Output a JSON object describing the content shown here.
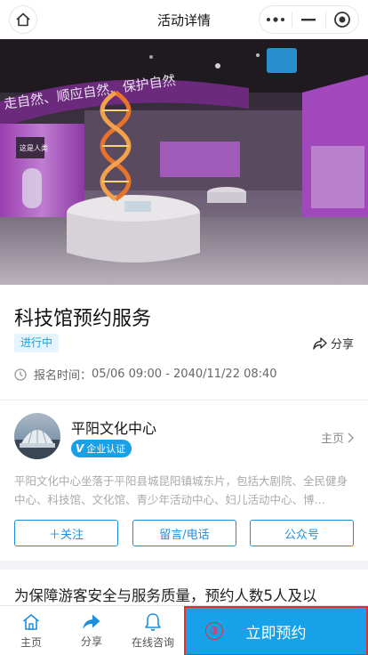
{
  "navbar": {
    "title": "活动详情",
    "icons": [
      "home-icon",
      "more-dots-icon",
      "minimize-icon",
      "close-target-icon"
    ]
  },
  "hero": {
    "banner_text": "走自然、顺应自然、保护自然",
    "sign_text": "这是人类"
  },
  "event": {
    "title": "科技馆预约服务",
    "status": "进行中",
    "share_label": "分享",
    "time_label": "报名时间：",
    "time_value": "05/06 09:00 - 2040/11/22 08:40"
  },
  "org": {
    "name": "平阳文化中心",
    "verify_v": "V",
    "verify_label": "企业认证",
    "homepage_label": "主页",
    "description": "平阳文化中心坐落于平阳县城昆阳镇城东片，包括大剧院、全民健身中心、科技馆、文化馆、青少年活动中心、妇儿活动中心、博…",
    "buttons": [
      "＋关注",
      "留言/电话",
      "公众号"
    ]
  },
  "notice": "为保障游客安全与服务质量，预约人数5人及以",
  "bottombar": {
    "tabs": [
      {
        "label": "主页",
        "icon": "home-icon"
      },
      {
        "label": "分享",
        "icon": "share-arrow-icon"
      },
      {
        "label": "在线咨询",
        "icon": "bell-icon"
      }
    ],
    "book_number": "③",
    "book_label": "立即预约"
  },
  "colors": {
    "accent": "#17a1e9",
    "highlight_border": "#e03030"
  }
}
